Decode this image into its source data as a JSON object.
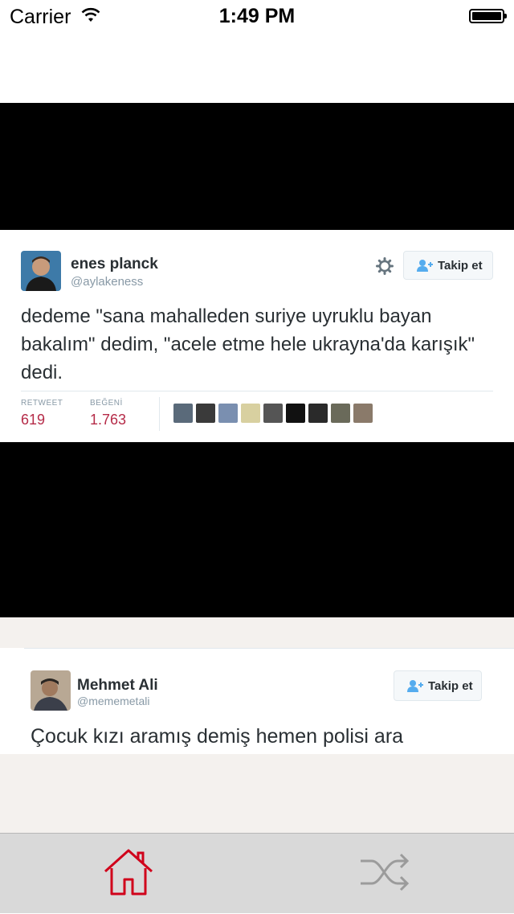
{
  "status_bar": {
    "carrier": "Carrier",
    "time": "1:49 PM",
    "icons": [
      "wifi-icon",
      "battery-icon"
    ]
  },
  "posts": [
    {
      "tweet": {
        "name": "enes planck",
        "handle": "@aylakeness",
        "follow_label": "Takip et",
        "text": "dedeme \"sana mahalleden suriye uyruklu bayan bakalım\" dedim, \"acele etme hele ukrayna'da karışık\" dedi.",
        "stats": {
          "retweet_label": "RETWEET",
          "retweet_count": "619",
          "like_label": "BEĞENİ",
          "like_count": "1.763"
        },
        "liker_colors": [
          "#5a6a7a",
          "#3a3a3a",
          "#7a8fb0",
          "#d8d0a0",
          "#555555",
          "#111111",
          "#2a2a2a",
          "#6a6a5a",
          "#8a7a6a"
        ]
      }
    },
    {
      "tweet": {
        "name": "Mehmet Ali",
        "handle": "@mememetali",
        "follow_label": "Takip et",
        "text": "Çocuk kızı aramış demiş hemen polisi ara"
      }
    }
  ],
  "tab_bar": {
    "tabs": [
      {
        "icon": "home-icon",
        "active": true
      },
      {
        "icon": "shuffle-icon",
        "active": false
      }
    ],
    "active_color": "#d0021b",
    "inactive_color": "#9b9b9b"
  },
  "colors": {
    "accent_count": "#b52b48",
    "background": "#f4f1ee"
  }
}
